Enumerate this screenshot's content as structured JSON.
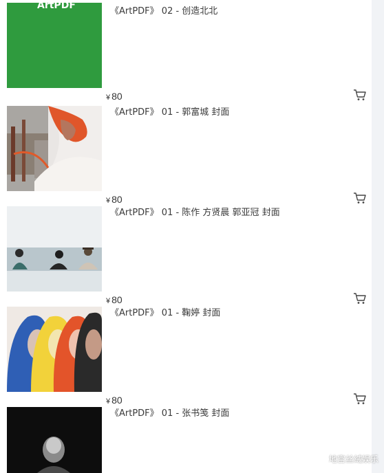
{
  "products": [
    {
      "title": "《ArtPDF》 02 - 创造北北",
      "currency": "¥",
      "price": "80",
      "cover_word": "ArtPDF",
      "cart_icon": "shopping-cart-icon"
    },
    {
      "title": "《ArtPDF》 01 - 郭富城 封面",
      "currency": "¥",
      "price": "80",
      "cart_icon": "shopping-cart-icon"
    },
    {
      "title": "《ArtPDF》 01 - 陈作 方贤晨 郭亚冠 封面",
      "currency": "¥",
      "price": "80",
      "cart_icon": "shopping-cart-icon"
    },
    {
      "title": "《ArtPDF》 01 - 鞠婷 封面",
      "currency": "¥",
      "price": "80",
      "cart_icon": "shopping-cart-icon"
    },
    {
      "title": "《ArtPDF》 01 - 张书笺 封面",
      "currency": "¥",
      "price": "80",
      "cart_icon": "shopping-cart-icon"
    }
  ],
  "watermark": "地宫丝绒娱乐",
  "colors": {
    "cover_green": "#2f9b3e",
    "price_text": "#333333",
    "title_text": "#3a3a3a",
    "gutter": "#f1f3f6"
  }
}
